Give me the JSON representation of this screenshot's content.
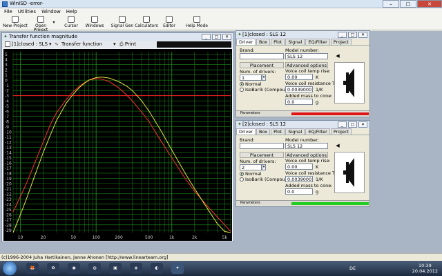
{
  "app": {
    "title": "WinISD -error-",
    "window_buttons": [
      "–",
      "□",
      "✕"
    ]
  },
  "menu": [
    "File",
    "Utilities",
    "Window",
    "Help"
  ],
  "toolbar": [
    {
      "label": "New Project",
      "icon": "new-project-icon"
    },
    {
      "label": "Open Project",
      "icon": "open-project-icon"
    },
    {
      "label": "Cursor",
      "icon": "cursor-icon"
    },
    {
      "label": "Windows",
      "icon": "windows-icon"
    },
    {
      "label": "Signal Gen",
      "icon": "signal-gen-icon"
    },
    {
      "label": "Calculators",
      "icon": "calculator-icon"
    },
    {
      "label": "Editor",
      "icon": "editor-icon"
    },
    {
      "label": "Help Mode",
      "icon": "help-mode-icon"
    }
  ],
  "chart_window": {
    "title": "Transfer function magnitude",
    "driver_select": "[1]closed : SLS 12",
    "graph_select": "Transfer function magnitude",
    "print_label": "Print",
    "mdi_buttons": [
      "_",
      "□",
      "✕"
    ]
  },
  "chart_data": {
    "type": "line",
    "y_ticks": [
      "5",
      "4",
      "3",
      "2",
      "1",
      "0",
      "-1",
      "-2",
      "-3",
      "-4",
      "-5",
      "-6",
      "-7",
      "-8",
      "-9",
      "-10",
      "-11",
      "-12",
      "-13",
      "-14",
      "-15",
      "-16",
      "-17",
      "-18",
      "-19",
      "-20",
      "-21",
      "-22",
      "-23",
      "-24",
      "-25",
      "-26",
      "-27",
      "-28",
      "-29"
    ],
    "x_ticks": [
      "10",
      "20",
      "50",
      "100",
      "200",
      "500",
      "1k",
      "2k",
      "5k"
    ],
    "x_tick_values": [
      10,
      20,
      50,
      100,
      200,
      500,
      1000,
      2000,
      5000
    ],
    "xlim": [
      8,
      6000
    ],
    "ylim": [
      -29.5,
      5.5
    ],
    "x_scale": "log",
    "grid": true,
    "reference_line_db": -3,
    "colors": {
      "background": "#000000",
      "grid": "#1a8a1a",
      "series1": "#ff3030",
      "series2": "#e6e640",
      "reference": "#ff2020"
    },
    "series": [
      {
        "color": "#ff3030",
        "x": [
          8,
          10,
          12,
          15,
          20,
          25,
          30,
          40,
          50,
          60,
          70,
          80,
          100,
          120,
          150,
          200,
          250,
          300,
          400,
          500,
          700,
          1000,
          1500,
          2000,
          3000,
          4000,
          5000,
          6000
        ],
        "y": [
          -25.5,
          -22.5,
          -20,
          -16.5,
          -12,
          -8.5,
          -6.3,
          -3.8,
          -2.2,
          -1.2,
          -0.5,
          0,
          0.3,
          0.2,
          -0.3,
          -1.5,
          -2.8,
          -4,
          -6.2,
          -8,
          -11.5,
          -15,
          -19,
          -21.5,
          -24.5,
          -26.5,
          -28,
          -29.3
        ]
      },
      {
        "color": "#e6e640",
        "x": [
          8,
          10,
          12,
          15,
          20,
          25,
          30,
          40,
          50,
          60,
          70,
          80,
          100,
          120,
          150,
          200,
          250,
          300,
          400,
          500,
          700,
          1000,
          1500,
          2000,
          3000,
          4000,
          5000,
          6000
        ],
        "y": [
          -29.5,
          -26,
          -23,
          -19,
          -14,
          -10.5,
          -7.8,
          -4.5,
          -2.7,
          -1.4,
          -0.6,
          0,
          0.5,
          0.6,
          0.4,
          -0.3,
          -1.1,
          -2,
          -4,
          -6,
          -9.5,
          -13.5,
          -18,
          -21,
          -25,
          -27.8,
          -29.3,
          -29.5
        ]
      }
    ]
  },
  "drivers": [
    {
      "title": "[1]closed : SLS 12",
      "tabs": [
        "Driver",
        "Box",
        "Plot",
        "Signal",
        "EQ/Filter",
        "Project"
      ],
      "brand_label": "Brand:",
      "brand_value": "",
      "model_label": "Model number:",
      "model_value": "SLS 12",
      "placement_label": "Placement",
      "num_drivers_label": "Num. of drivers:",
      "num_drivers_value": "1",
      "normal_label": "Normal",
      "isobarik_label": "IsoBarik (Compound)",
      "advanced_label": "Advanced options",
      "vc_temp_label": "Voice coil temp rise:",
      "vc_temp_value": "0.00",
      "vc_temp_unit": "K",
      "vc_res_label": "Voice coil resistance TC:",
      "vc_res_value": "0.0039000",
      "vc_res_unit": "1/K",
      "mass_label": "Added mass to cone:",
      "mass_value": "0.0",
      "mass_unit": "g",
      "params_label": "Parameters",
      "status_color": "#e01414"
    },
    {
      "title": "[2]closed : SLS 12",
      "tabs": [
        "Driver",
        "Box",
        "Plot",
        "Signal",
        "EQ/Filter",
        "Project"
      ],
      "brand_label": "Brand:",
      "brand_value": "",
      "model_label": "Model number:",
      "model_value": "SLS 12",
      "placement_label": "Placement",
      "num_drivers_label": "Num. of drivers:",
      "num_drivers_value": "2",
      "normal_label": "Normal",
      "isobarik_label": "IsoBarik (Compound)",
      "advanced_label": "Advanced options",
      "vc_temp_label": "Voice coil temp rise:",
      "vc_temp_value": "0.00",
      "vc_temp_unit": "K",
      "vc_res_label": "Voice coil resistance TC:",
      "vc_res_value": "0.0039000",
      "vc_res_unit": "1/K",
      "mass_label": "Added mass to cone:",
      "mass_value": "0.0",
      "mass_unit": "g",
      "params_label": "Parameters",
      "status_color": "#22cc22"
    }
  ],
  "status_bar": "(c)1996-2004 Juha Hartikainen, Janne Ahonen [http://www.linearteam.org]",
  "taskbar": {
    "language": "DE",
    "time": "10:39",
    "date": "20.04.2012"
  }
}
